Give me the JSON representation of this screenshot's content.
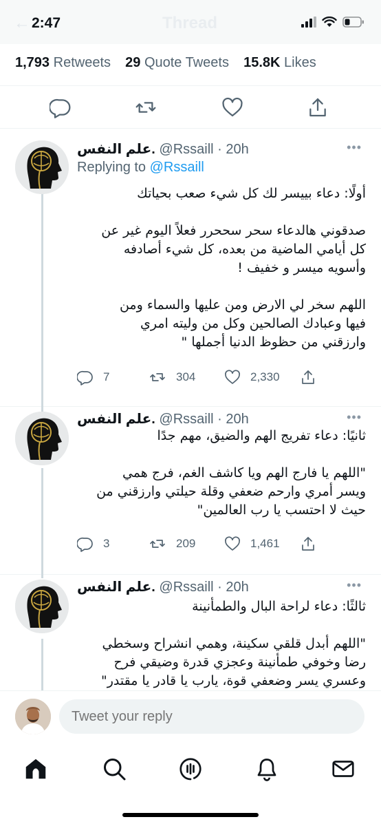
{
  "status_bar": {
    "time": "2:47",
    "ghost_back": "←",
    "ghost_title": "Thread"
  },
  "stats": {
    "retweets_count": "1,793",
    "retweets_label": "Retweets",
    "quotes_count": "29",
    "quotes_label": "Quote Tweets",
    "likes_count": "15.8K",
    "likes_label": "Likes"
  },
  "replies": [
    {
      "name": "علم النفس.",
      "handle_time": "@Rssaill · 20h",
      "more": "•••",
      "replying_prefix": "Replying to",
      "replying_handle": "@Rssaill",
      "lines": [
        "أولًا: دعاء بييسر لك كل شيء صعب بحياتك",
        "",
        "صدقوني هالدعاء سحر سححرر فعلاً اليوم غير عن",
        "كل أيامي الماضية من بعده، كل شيء أصادفه",
        "وأسويه ميسر و خفيف !",
        "",
        "اللهم سخر لي الارض ومن عليها والسماء ومن",
        "فيها وعبادك الصالحين وكل من وليته امري",
        "وارزقني من حظوظ الدنيا أجملها \""
      ],
      "reply_count": "7",
      "retweet_count": "304",
      "like_count": "2,330"
    },
    {
      "name": "علم النفس.",
      "handle_time": "@Rssaill · 20h",
      "more": "•••",
      "lines": [
        "ثانيًا: دعاء تفريج الهم والضيق، مهم جدًا",
        "",
        "\"اللهم يا فارج الهم ويا كاشف الغم، فرج همي",
        "ويسر أمري وارحم ضعفي وقلة حيلتي وارزقني من",
        "حيث لا احتسب يا رب العالمين\""
      ],
      "reply_count": "3",
      "retweet_count": "209",
      "like_count": "1,461"
    },
    {
      "name": "علم النفس.",
      "handle_time": "@Rssaill · 20h",
      "more": "•••",
      "lines": [
        "ثالثًا: دعاء لراحة البال والطمأنينة",
        "",
        "\"اللهم أبدل قلقي سكينة، وهمي انشراح وسخطي",
        "رضا وخوفي طمأنينة وعجزي قدرة وضيقي فرح",
        "وعسري يسر وضعفي قوة، يارب يا قادر يا مقتدر\""
      ]
    }
  ],
  "reply_bar": {
    "placeholder": "Tweet your reply"
  },
  "icons": {
    "reply": "reply-icon",
    "retweet": "retweet-icon",
    "like": "heart-icon",
    "share": "share-icon",
    "home": "home-icon",
    "search": "search-icon",
    "spaces": "spaces-icon",
    "notifications": "bell-icon",
    "messages": "mail-icon"
  },
  "colors": {
    "accent": "#1d9bf0",
    "muted": "#536471",
    "text": "#0f1419"
  }
}
